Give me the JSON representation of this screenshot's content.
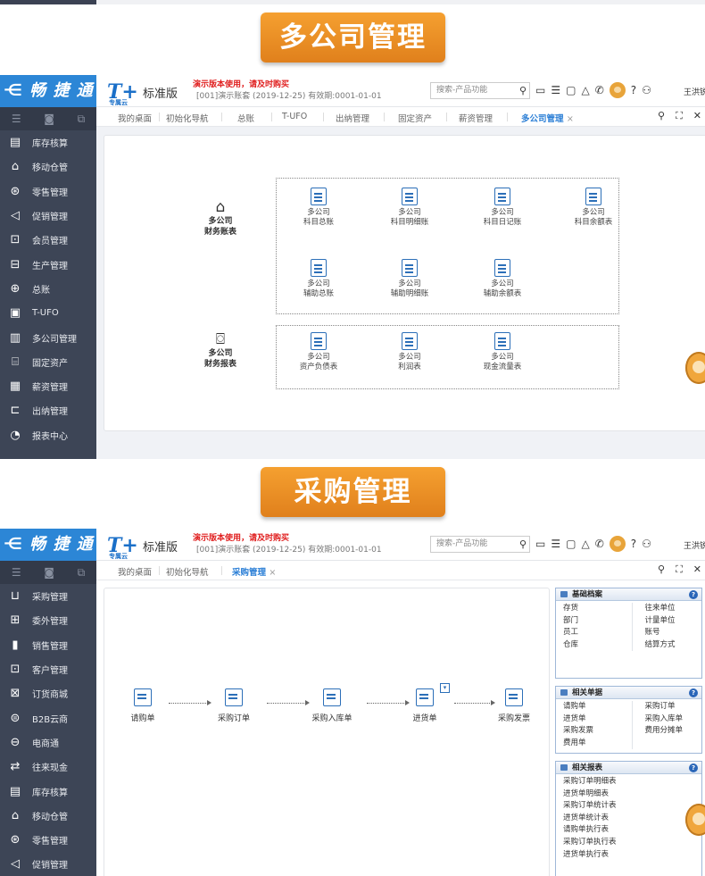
{
  "banners": {
    "top": "多公司管理",
    "bottom": "采购管理"
  },
  "app1": {
    "logo": "⋲ 畅 捷 通",
    "t_logo": "T+",
    "t_sub": "专属云",
    "edition": "标准版",
    "demo_notice": "演示版本使用，请及时购买",
    "account_info": "[001]演示账套  (2019-12-25)  有效期:0001-01-01",
    "search_placeholder": "搜索-产品功能",
    "user": "王洪锐",
    "tabs": [
      "我的桌面",
      "初始化导航",
      "总账",
      "T-UFO",
      "出纳管理",
      "固定资产",
      "薪资管理",
      "多公司管理"
    ],
    "active_tab_close": "×",
    "sidebar": [
      "库存核算",
      "移动仓管",
      "零售管理",
      "促销管理",
      "会员管理",
      "生产管理",
      "总账",
      "T-UFO",
      "多公司管理",
      "固定资产",
      "薪资管理",
      "出纳管理",
      "报表中心"
    ],
    "categories": [
      {
        "line1": "多公司",
        "line2": "财务账表"
      },
      {
        "line1": "多公司",
        "line2": "财务报表"
      }
    ],
    "ledger_items": [
      {
        "l1": "多公司",
        "l2": "科目总账"
      },
      {
        "l1": "多公司",
        "l2": "科目明细账"
      },
      {
        "l1": "多公司",
        "l2": "科目日记账"
      },
      {
        "l1": "多公司",
        "l2": "科目余额表"
      },
      {
        "l1": "多公司",
        "l2": "辅助总账"
      },
      {
        "l1": "多公司",
        "l2": "辅助明细账"
      },
      {
        "l1": "多公司",
        "l2": "辅助余额表"
      }
    ],
    "report_items": [
      {
        "l1": "多公司",
        "l2": "资产负债表"
      },
      {
        "l1": "多公司",
        "l2": "利润表"
      },
      {
        "l1": "多公司",
        "l2": "现金流量表"
      }
    ]
  },
  "app2": {
    "logo": "⋲ 畅 捷 通",
    "t_logo": "T+",
    "t_sub": "专属云",
    "edition": "标准版",
    "demo_notice": "演示版本使用，请及时购买",
    "account_info": "[001]演示账套  (2019-12-25)  有效期:0001-01-01",
    "search_placeholder": "搜索-产品功能",
    "user": "王洪锐",
    "tabs": [
      "我的桌面",
      "初始化导航",
      "采购管理"
    ],
    "active_tab_close": "×",
    "sidebar": [
      "采购管理",
      "委外管理",
      "销售管理",
      "客户管理",
      "订货商城",
      "B2B云商",
      "电商通",
      "往来现金",
      "库存核算",
      "移动仓管",
      "零售管理",
      "促销管理"
    ],
    "flow": [
      "请购单",
      "采购订单",
      "采购入库单",
      "进货单",
      "采购发票"
    ],
    "basic": {
      "title": "基础档案",
      "col1": [
        "存货",
        "部门",
        "员工",
        "仓库"
      ],
      "col2": [
        "往来单位",
        "计量单位",
        "账号",
        "结算方式"
      ]
    },
    "docs": {
      "title": "相关单据",
      "col1": [
        "请购单",
        "进货单",
        "采购发票",
        "费用单"
      ],
      "col2": [
        "采购订单",
        "采购入库单",
        "费用分摊单"
      ]
    },
    "reports": {
      "title": "相关报表",
      "items": [
        "采购订单明细表",
        "进货单明细表",
        "采购订单统计表",
        "进货单统计表",
        "请购单执行表",
        "采购订单执行表",
        "进货单执行表"
      ]
    }
  }
}
